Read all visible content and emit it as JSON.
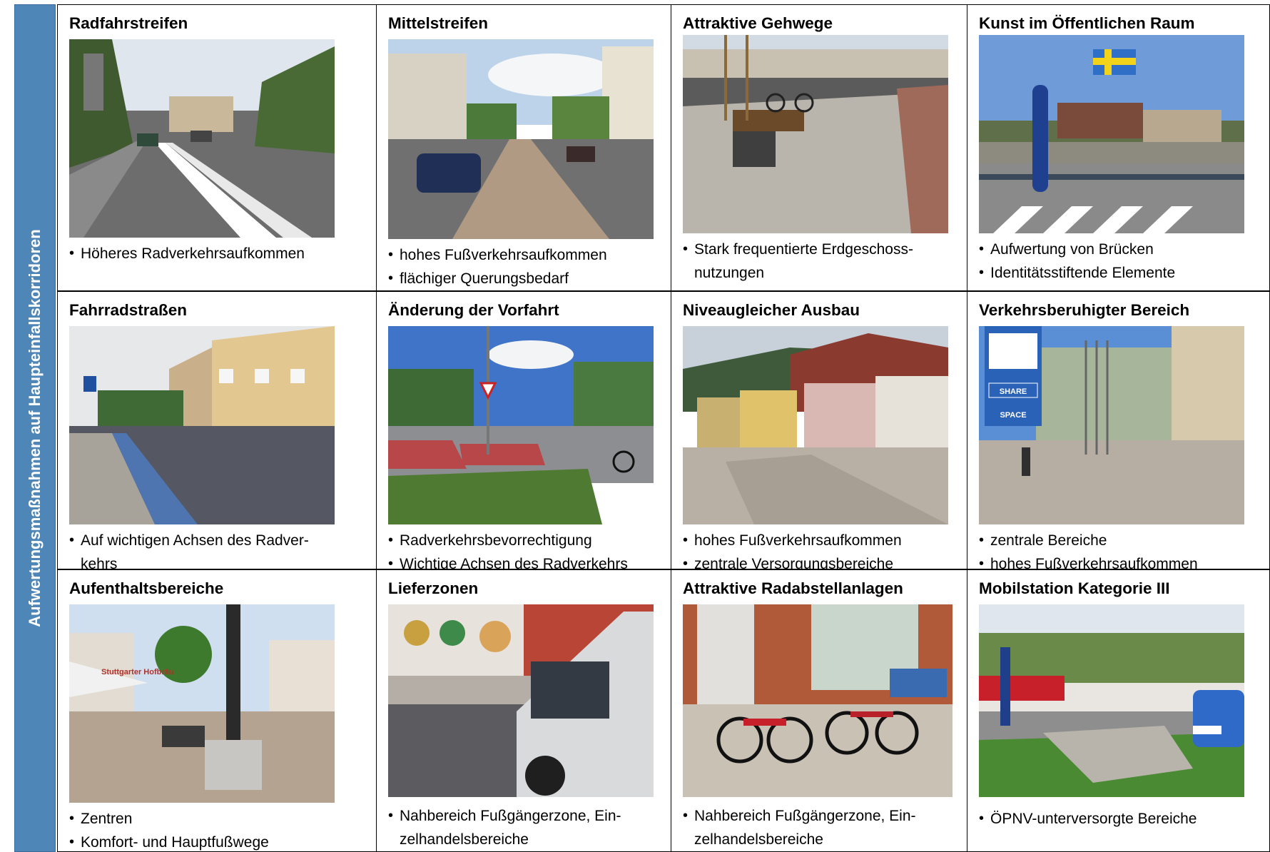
{
  "side_label": "Aufwertungsmaßnahmen auf Haupteinfallskorridoren",
  "cells": [
    {
      "title": "Radfahrstreifen",
      "bullets": [
        "Höheres Radverkehrsaufkommen"
      ]
    },
    {
      "title": "Mittelstreifen",
      "bullets": [
        "hohes Fußverkehrsaufkommen",
        "flächiger Querungsbedarf"
      ]
    },
    {
      "title": "Attraktive Gehwege",
      "bullets": [
        "Stark frequentierte Erdgeschoss-",
        "nutzungen"
      ]
    },
    {
      "title": "Kunst im Öffentlichen Raum",
      "bullets": [
        "Aufwertung von Brücken",
        "Identitätsstiftende Elemente"
      ]
    },
    {
      "title": "Fahrradstraßen",
      "bullets": [
        "Auf wichtigen Achsen des Radver-",
        "kehrs"
      ]
    },
    {
      "title": "Änderung der Vorfahrt",
      "bullets": [
        "Radverkehrsbevorrechtigung",
        "Wichtige Achsen des Radverkehrs"
      ]
    },
    {
      "title": "Niveaugleicher Ausbau",
      "bullets": [
        "hohes Fußverkehrsaufkommen",
        "zentrale Versorgungsbereiche"
      ]
    },
    {
      "title": "Verkehrsberuhigter Bereich",
      "bullets": [
        "zentrale Bereiche",
        "hohes Fußverkehrsaufkommen"
      ]
    },
    {
      "title": "Aufenthaltsbereiche",
      "bullets": [
        "Zentren",
        "Komfort- und Hauptfußwege"
      ]
    },
    {
      "title": "Lieferzonen",
      "bullets": [
        "Nahbereich Fußgängerzone, Ein-",
        "zelhandelsbereiche"
      ]
    },
    {
      "title": "Attraktive Radabstellanlagen",
      "bullets": [
        "Nahbereich Fußgängerzone, Ein-",
        "zelhandelsbereiche"
      ]
    },
    {
      "title": "Mobilstation Kategorie III",
      "bullets": [
        "ÖPNV-unterversorgte Bereiche"
      ]
    }
  ],
  "photo_texts": {
    "share_space_1": "SHARE",
    "share_space_2": "SPACE",
    "umbrella_text": "Stuttgarter Hofbräu"
  }
}
